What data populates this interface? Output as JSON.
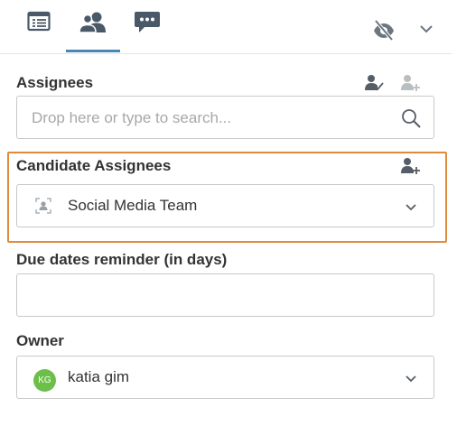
{
  "tabs": [
    {
      "name": "details",
      "icon": "table-icon",
      "active": false
    },
    {
      "name": "people",
      "icon": "users-icon",
      "active": true
    },
    {
      "name": "comments",
      "icon": "chat-icon",
      "active": false
    }
  ],
  "colors": {
    "accent": "#4a88b4",
    "highlight": "#e08a3c",
    "avatar": "#6cc04a"
  },
  "assignees": {
    "label": "Assignees",
    "placeholder": "Drop here or type to search..."
  },
  "candidate_assignees": {
    "label": "Candidate Assignees",
    "value": "Social Media Team"
  },
  "due_dates": {
    "label": "Due dates reminder (in days)",
    "value": ""
  },
  "owner": {
    "label": "Owner",
    "initials": "KG",
    "value": "katia gim"
  }
}
